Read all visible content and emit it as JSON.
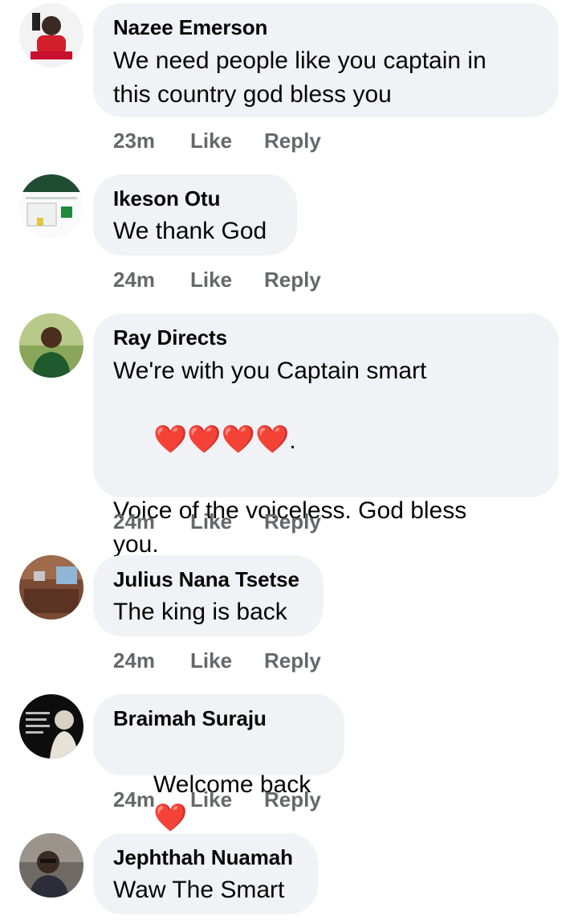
{
  "comments": [
    {
      "author": "Nazee Emerson",
      "text_lines": [
        "We need people like you captain in",
        "this country god bless you"
      ],
      "time": "23m",
      "like": "Like",
      "reply": "Reply",
      "avatar_icon": "profile-photo-icon"
    },
    {
      "author": "Ikeson Otu",
      "text_lines": [
        "We thank God"
      ],
      "time": "24m",
      "like": "Like",
      "reply": "Reply",
      "avatar_icon": "profile-photo-icon"
    },
    {
      "author": "Ray Directs",
      "text_lines": [
        "We're with you Captain smart",
        ".",
        "Voice of the voiceless. God bless",
        "you."
      ],
      "hearts": "❤️❤️❤️❤️",
      "time": "24m",
      "like": "Like",
      "reply": "Reply",
      "avatar_icon": "profile-photo-icon"
    },
    {
      "author": "Julius Nana Tsetse",
      "text_lines": [
        "The king is back"
      ],
      "time": "24m",
      "like": "Like",
      "reply": "Reply",
      "avatar_icon": "profile-photo-icon"
    },
    {
      "author": "Braimah Suraju",
      "text_lines": [
        "Welcome back"
      ],
      "heart": "❤️",
      "time": "24m",
      "like": "Like",
      "reply": "Reply",
      "avatar_icon": "profile-photo-icon"
    },
    {
      "author": "Jephthah Nuamah",
      "text_lines": [
        "Waw The Smart"
      ],
      "avatar_icon": "profile-photo-icon"
    }
  ],
  "colors": {
    "bubble": "#f0f2f5",
    "meta": "#65676b",
    "heart": "#e41e3f"
  }
}
